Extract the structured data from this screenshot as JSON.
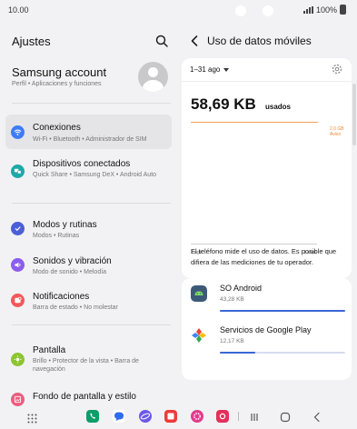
{
  "status_bar": {
    "time": "10.00",
    "battery": "100%"
  },
  "settings": {
    "title": "Ajustes",
    "account": {
      "name": "Samsung account",
      "subtitle": "Perfil  •  Aplicaciones y funciones"
    },
    "items": [
      {
        "title": "Conexiones",
        "subtitle": "Wi-Fi  •  Bluetooth  •  Administrador de SIM",
        "icon": "wifi-icon",
        "color": "#3d7cf5"
      },
      {
        "title": "Dispositivos conectados",
        "subtitle": "Quick Share  •  Samsung DeX  •  Android Auto",
        "icon": "devices-icon",
        "color": "#1fa8a8"
      },
      {
        "title": "Modos y rutinas",
        "subtitle": "Modos  •  Rutinas",
        "icon": "check-circle-icon",
        "color": "#4b5fd6"
      },
      {
        "title": "Sonidos y vibración",
        "subtitle": "Modo de sonido  •  Melodía",
        "icon": "speaker-icon",
        "color": "#8b5cf0"
      },
      {
        "title": "Notificaciones",
        "subtitle": "Barra de estado  •  No molestar",
        "icon": "bell-icon",
        "color": "#ef5a5a"
      },
      {
        "title": "Pantalla",
        "subtitle": "Brillo  •  Protector de la vista  •  Barra de navegación",
        "icon": "sun-icon",
        "color": "#8cc532"
      },
      {
        "title": "Fondo de pantalla y estilo",
        "subtitle": "",
        "icon": "wallpaper-icon",
        "color": "#ee5b7e"
      }
    ]
  },
  "data_usage": {
    "title": "Uso de datos móviles",
    "period": "1–31 ago",
    "usage_value": "58,69 KB",
    "usage_unit": "usados",
    "limit_value": "2,0 GB",
    "limit_label": "Aviso",
    "axis_start": "1 ago",
    "axis_end": "1 sept",
    "info": "El teléfono mide el uso de datos. Es posible que difiera de las mediciones de tu operador.",
    "apps": [
      {
        "name": "SO Android",
        "size": "43,28 KB",
        "share": 1.0,
        "icon": "android-icon"
      },
      {
        "name": "Servicios de Google Play",
        "size": "12,17 KB",
        "share": 0.28,
        "icon": "google-play-services-icon"
      }
    ]
  },
  "colors": {
    "accent": "#3a66d8",
    "warning": "#f08a3a"
  }
}
